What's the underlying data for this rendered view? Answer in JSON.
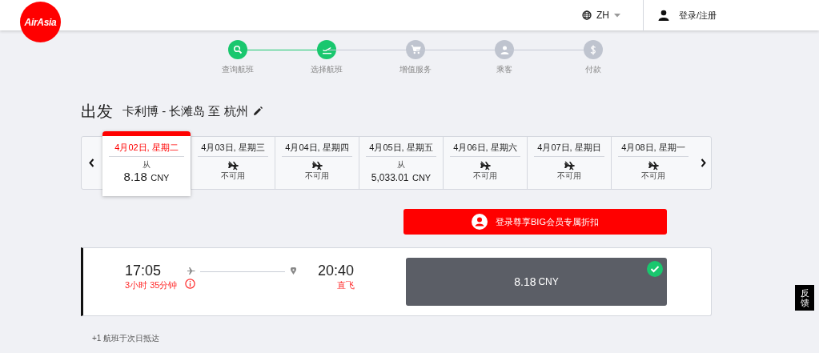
{
  "header": {
    "logo": "AirAsia",
    "language": "ZH",
    "login": "登录/注册"
  },
  "steps": [
    {
      "label": "查询航班",
      "done": true
    },
    {
      "label": "选择航班",
      "done": true
    },
    {
      "label": "增值服务",
      "done": false
    },
    {
      "label": "乘客",
      "done": false
    },
    {
      "label": "付款",
      "done": false
    }
  ],
  "heading": {
    "title": "出发",
    "route": "卡利博 - 长滩岛 至 杭州"
  },
  "dates": [
    {
      "date": "4月02日, 星期二",
      "kind": "price",
      "from": "从",
      "amount": "8.18",
      "currency": "CNY",
      "selected": true
    },
    {
      "date": "4月03日, 星期三",
      "kind": "unavailable",
      "note": "不可用",
      "selected": false
    },
    {
      "date": "4月04日, 星期四",
      "kind": "unavailable",
      "note": "不可用",
      "selected": false
    },
    {
      "date": "4月05日, 星期五",
      "kind": "price",
      "from": "从",
      "amount": "5,033.01",
      "currency": "CNY",
      "selected": false
    },
    {
      "date": "4月06日, 星期六",
      "kind": "unavailable",
      "note": "不可用",
      "selected": false
    },
    {
      "date": "4月07日, 星期日",
      "kind": "unavailable",
      "note": "不可用",
      "selected": false
    },
    {
      "date": "4月08日, 星期一",
      "kind": "unavailable",
      "note": "不可用",
      "selected": false
    }
  ],
  "member_button": "登录尊享BIG会员专属折扣",
  "flight": {
    "depart": "17:05",
    "duration": "3小时 35分钟",
    "arrive": "20:40",
    "stops": "直飞",
    "amount": "8.18",
    "currency": "CNY",
    "selected": true
  },
  "footnote": "+1 航班于次日抵达",
  "feedback": "反馈"
}
